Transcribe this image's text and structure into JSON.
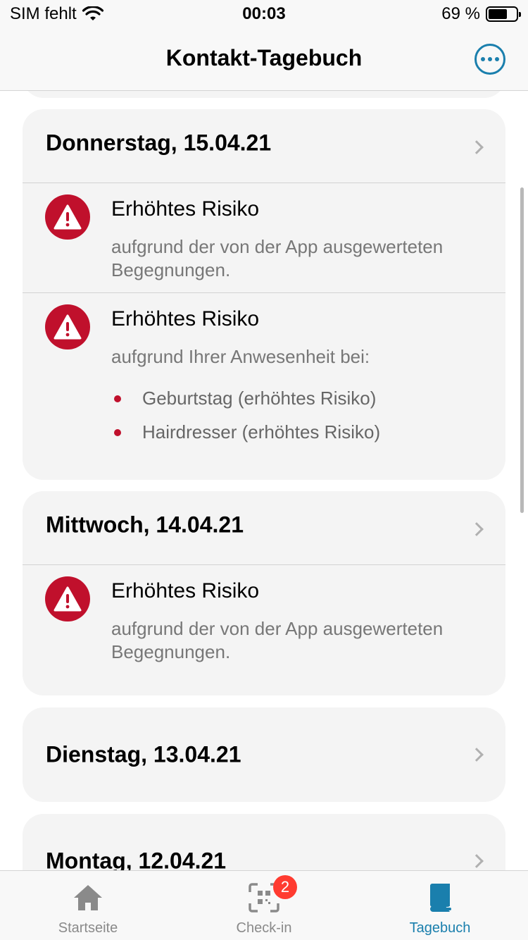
{
  "status_bar": {
    "carrier": "SIM fehlt",
    "time": "00:03",
    "battery": "69 %",
    "battery_level": 0.69
  },
  "header": {
    "title": "Kontakt-Tagebuch",
    "more_icon": "ellipsis-circle-icon"
  },
  "days": [
    {
      "label": "Donnerstag, 15.04.21",
      "entries": [
        {
          "title": "Erhöhtes Risiko",
          "text": "aufgrund der von der App ausgewerteten Begegnungen."
        },
        {
          "title": "Erhöhtes Risiko",
          "text": "aufgrund Ihrer Anwesenheit bei:",
          "items": [
            "Geburtstag (erhöhtes Risiko)",
            "Hairdresser (erhöhtes Risiko)"
          ]
        }
      ]
    },
    {
      "label": "Mittwoch, 14.04.21",
      "entries": [
        {
          "title": "Erhöhtes Risiko",
          "text": "aufgrund der von der App ausgewerteten Begegnungen."
        }
      ]
    },
    {
      "label": "Dienstag, 13.04.21",
      "entries": []
    },
    {
      "label": "Montag, 12.04.21",
      "entries": []
    }
  ],
  "tabbar": {
    "tabs": [
      {
        "label": "Startseite",
        "icon": "home-icon"
      },
      {
        "label": "Check-in",
        "icon": "qr-scan-icon",
        "badge": "2"
      },
      {
        "label": "Tagebuch",
        "icon": "book-icon",
        "active": true
      }
    ]
  },
  "colors": {
    "accent": "#1a7fad",
    "risk": "#c0102c",
    "badge": "#ff3b30"
  }
}
